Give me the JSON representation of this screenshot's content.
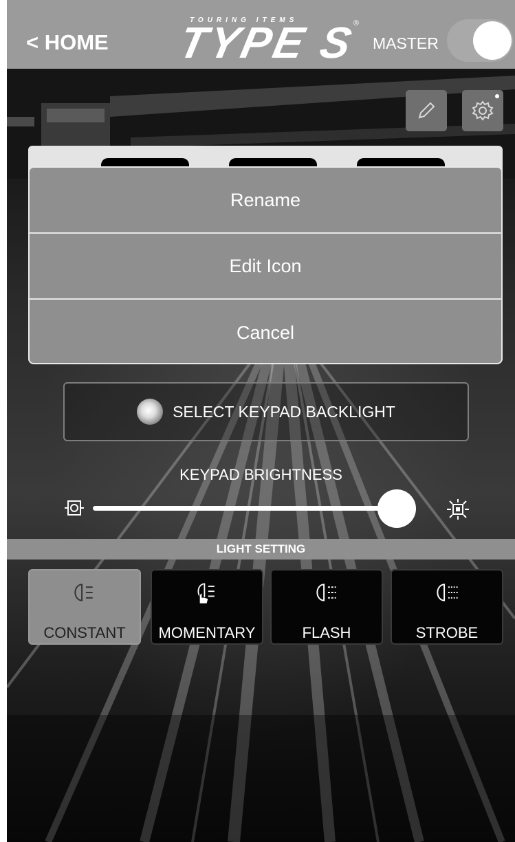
{
  "header": {
    "home_label": "< HOME",
    "logo_sub": "TOURING ITEMS",
    "logo_main": "TYPE S",
    "logo_reg": "®",
    "master_label": "MASTER",
    "master_on": true
  },
  "tools": {
    "edit_icon": "pencil-icon",
    "settings_icon": "gear-icon"
  },
  "action_sheet": {
    "items": [
      {
        "label": "Rename"
      },
      {
        "label": "Edit Icon"
      },
      {
        "label": "Cancel"
      }
    ]
  },
  "backlight": {
    "label": "SELECT KEYPAD BACKLIGHT"
  },
  "brightness": {
    "title": "KEYPAD BRIGHTNESS",
    "value": 0.94
  },
  "light_setting": {
    "title": "LIGHT SETTING",
    "modes": [
      {
        "label": "CONSTANT",
        "icon": "headlight-icon",
        "active": true
      },
      {
        "label": "MOMENTARY",
        "icon": "headlight-touch-icon",
        "active": false
      },
      {
        "label": "FLASH",
        "icon": "headlight-flash-icon",
        "active": false
      },
      {
        "label": "STROBE",
        "icon": "headlight-strobe-icon",
        "active": false
      }
    ]
  },
  "colors": {
    "header_bg": "#9b9b9b",
    "sheet_bg": "#8f8f8f",
    "active_mode_bg": "#8e8e8e"
  }
}
